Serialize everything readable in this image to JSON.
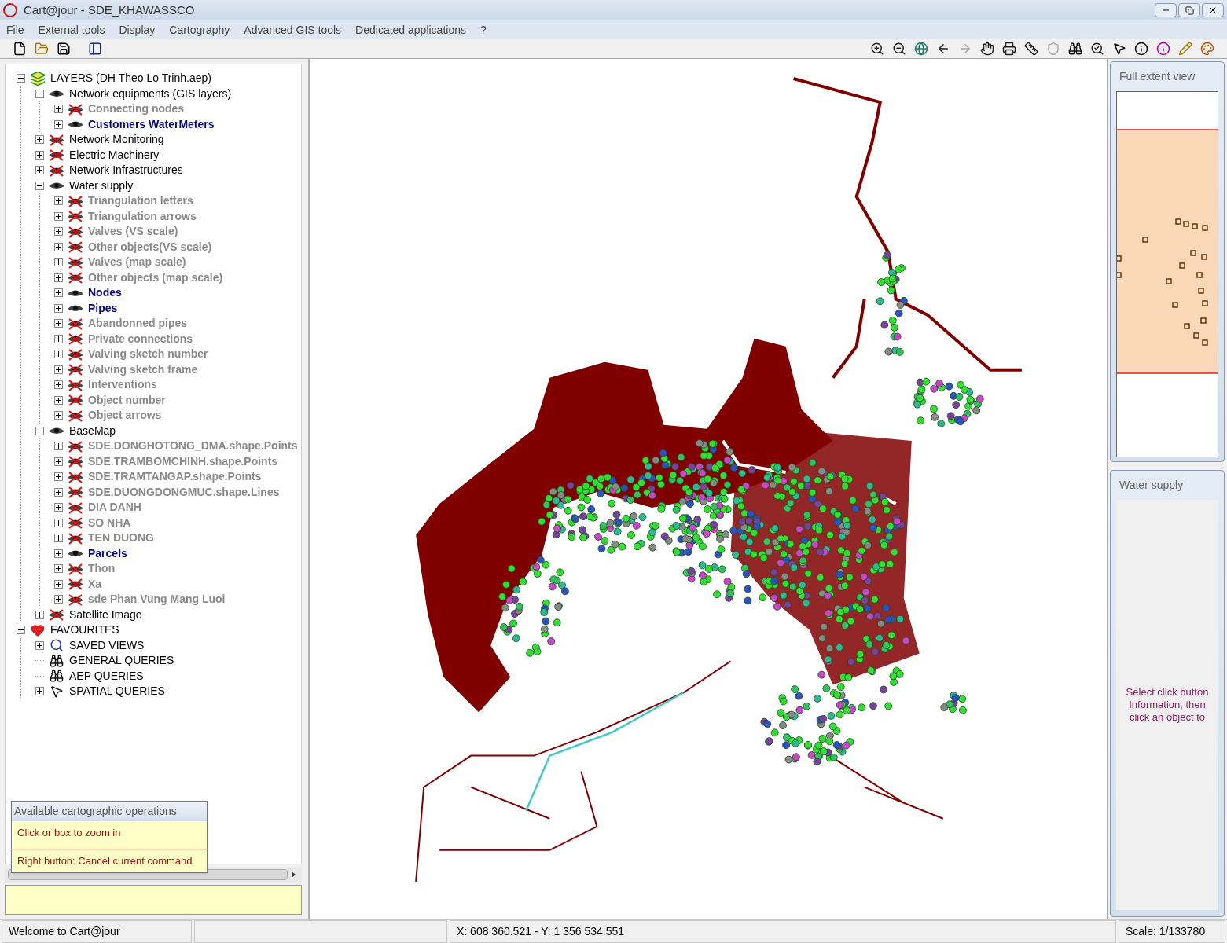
{
  "window": {
    "title": "Cart@jour - SDE_KHAWASSCO"
  },
  "menu": [
    "File",
    "External tools",
    "Display",
    "Cartography",
    "Advanced GIS tools",
    "Dedicated applications",
    "?"
  ],
  "tree": [
    {
      "label": "LAYERS (DH Theo Lo Trinh.aep)",
      "kind": "layers",
      "expanded": true,
      "children": [
        {
          "label": "Network equipments (GIS layers)",
          "kind": "layer",
          "visible": true,
          "expanded": true,
          "children": [
            {
              "label": "Connecting nodes",
              "kind": "layer",
              "visible": false,
              "expanded": false
            },
            {
              "label": "Customers WaterMeters",
              "kind": "layer",
              "visible": true,
              "expanded": false
            }
          ]
        },
        {
          "label": "Network Monitoring",
          "kind": "layer",
          "visible": false,
          "expanded": false
        },
        {
          "label": "Electric Machinery",
          "kind": "layer",
          "visible": false,
          "expanded": false
        },
        {
          "label": "Network Infrastructures",
          "kind": "layer",
          "visible": false,
          "expanded": false
        },
        {
          "label": "Water supply",
          "kind": "layer",
          "visible": true,
          "expanded": true,
          "children": [
            {
              "label": "Triangulation letters",
              "kind": "layer",
              "visible": false,
              "expanded": false
            },
            {
              "label": "Triangulation arrows",
              "kind": "layer",
              "visible": false,
              "expanded": false
            },
            {
              "label": "Valves (VS scale)",
              "kind": "layer",
              "visible": false,
              "expanded": false
            },
            {
              "label": "Other objects(VS scale)",
              "kind": "layer",
              "visible": false,
              "expanded": false
            },
            {
              "label": "Valves (map scale)",
              "kind": "layer",
              "visible": false,
              "expanded": false
            },
            {
              "label": "Other objects (map scale)",
              "kind": "layer",
              "visible": false,
              "expanded": false
            },
            {
              "label": "Nodes",
              "kind": "layer",
              "visible": true,
              "expanded": false
            },
            {
              "label": "Pipes",
              "kind": "layer",
              "visible": true,
              "expanded": false
            },
            {
              "label": "Abandonned pipes",
              "kind": "layer",
              "visible": false,
              "expanded": false
            },
            {
              "label": "Private connections",
              "kind": "layer",
              "visible": false,
              "expanded": false
            },
            {
              "label": "Valving sketch number",
              "kind": "layer",
              "visible": false,
              "expanded": false
            },
            {
              "label": "Valving sketch frame",
              "kind": "layer",
              "visible": false,
              "expanded": false
            },
            {
              "label": "Interventions",
              "kind": "layer",
              "visible": false,
              "expanded": false
            },
            {
              "label": "Object number",
              "kind": "layer",
              "visible": false,
              "expanded": false
            },
            {
              "label": "Object arrows",
              "kind": "layer",
              "visible": false,
              "expanded": false
            }
          ]
        },
        {
          "label": "BaseMap",
          "kind": "layer",
          "visible": true,
          "expanded": true,
          "children": [
            {
              "label": "SDE.DONGHOTONG_DMA.shape.Points",
              "kind": "layer",
              "visible": false,
              "expanded": false
            },
            {
              "label": "SDE.TRAMBOMCHINH.shape.Points",
              "kind": "layer",
              "visible": false,
              "expanded": false
            },
            {
              "label": "SDE.TRAMTANGAP.shape.Points",
              "kind": "layer",
              "visible": false,
              "expanded": false
            },
            {
              "label": "SDE.DUONGDONGMUC.shape.Lines",
              "kind": "layer",
              "visible": false,
              "expanded": false
            },
            {
              "label": "DIA DANH",
              "kind": "layer",
              "visible": false,
              "expanded": false
            },
            {
              "label": "SO NHA",
              "kind": "layer",
              "visible": false,
              "expanded": false
            },
            {
              "label": "TEN DUONG",
              "kind": "layer",
              "visible": false,
              "expanded": false
            },
            {
              "label": "Parcels",
              "kind": "layer",
              "visible": true,
              "expanded": false
            },
            {
              "label": "Thon",
              "kind": "layer",
              "visible": false,
              "expanded": false
            },
            {
              "label": "Xa",
              "kind": "layer",
              "visible": false,
              "expanded": false
            },
            {
              "label": "sde Phan Vung Mang Luoi",
              "kind": "layer",
              "visible": false,
              "expanded": false
            }
          ]
        },
        {
          "label": "Satellite Image",
          "kind": "layer",
          "visible": false,
          "expanded": false
        }
      ]
    },
    {
      "label": "FAVOURITES",
      "kind": "favourites",
      "expanded": true,
      "children": [
        {
          "label": "SAVED VIEWS",
          "kind": "views",
          "expanded": false
        },
        {
          "label": "GENERAL QUERIES",
          "kind": "query"
        },
        {
          "label": "AEP QUERIES",
          "kind": "query"
        },
        {
          "label": "SPATIAL QUERIES",
          "kind": "spatial",
          "expanded": false
        }
      ]
    }
  ],
  "operations": {
    "title": "Available cartographic operations",
    "items": [
      "Click or box to zoom in",
      "Right button: Cancel current command"
    ]
  },
  "overview": {
    "title": "Full extent view"
  },
  "info_panel": {
    "title": "Water supply",
    "message": "Select click button Information, then click an object to"
  },
  "status_bar": {
    "message": "Welcome to Cart@jour",
    "coordinates": "X: 608 360.521 - Y: 1 356 534.551",
    "scale": "Scale: 1/133780"
  }
}
